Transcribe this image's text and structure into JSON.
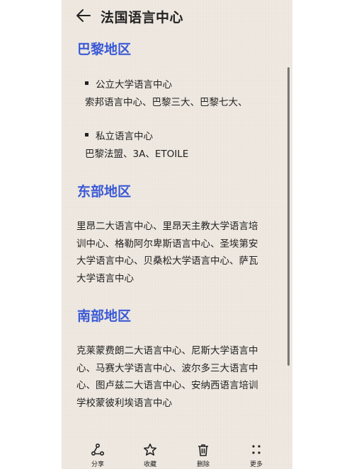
{
  "header": {
    "title": "法国语言中心",
    "back_icon": "arrow-left-icon"
  },
  "sections": [
    {
      "title": "巴黎地区",
      "items": [
        {
          "label": "公立大学语言中心",
          "text": "索邦语言中心、巴黎三大、巴黎七大、"
        },
        {
          "label": "私立语言中心",
          "text": "巴黎法盟、3A、ETOILE"
        }
      ]
    },
    {
      "title": "东部地区",
      "lines": [
        "里昂二大语言中心、里昂天主教大学语言培",
        "训中心、格勒阿尔卑斯语言中心、圣埃第安",
        "大学语言中心、贝桑松大学语言中心、萨瓦",
        "大学语言中心"
      ]
    },
    {
      "title": "南部地区",
      "lines": [
        "克莱蒙费朗二大语言中心、尼斯大学语言中",
        "心、马赛大学语言中心、波尔多三大语言中",
        "心、图卢兹二大语言中心、安纳西语言培训",
        "学校蒙彼利埃语言中心"
      ]
    }
  ],
  "toolbar": {
    "share": {
      "label": "分享",
      "icon": "share-icon"
    },
    "favorite": {
      "label": "收藏",
      "icon": "star-icon"
    },
    "delete": {
      "label": "删除",
      "icon": "trash-icon"
    },
    "more": {
      "label": "更多",
      "icon": "more-dots-icon"
    }
  },
  "colors": {
    "accent": "#3a59d6",
    "background": "#efe9e1",
    "text": "#222222"
  }
}
